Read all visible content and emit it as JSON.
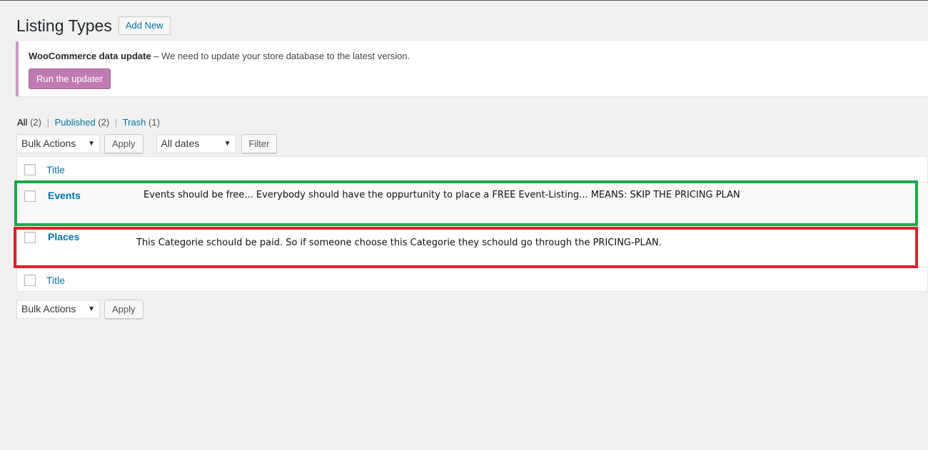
{
  "page": {
    "title": "Listing Types",
    "add_new_label": "Add New"
  },
  "notice": {
    "title": "WooCommerce data update",
    "message": " – We need to update your store database to the latest version.",
    "button_label": "Run the updater"
  },
  "views": [
    {
      "label": "All",
      "count": "(2)"
    },
    {
      "label": "Published",
      "count": "(2)"
    },
    {
      "label": "Trash",
      "count": "(1)"
    }
  ],
  "separator": "|",
  "tablenav_top": {
    "bulk_actions": "Bulk Actions",
    "apply": "Apply",
    "dates": "All dates",
    "filter": "Filter"
  },
  "tablenav_bottom": {
    "bulk_actions": "Bulk Actions",
    "apply": "Apply"
  },
  "table": {
    "column_title": "Title",
    "rows": [
      {
        "title": "Events",
        "note": "Events should be free... Everybody should have the oppurtunity to place a FREE Event-Listing... MEANS: SKIP THE PRICING PLAN"
      },
      {
        "title": "Places",
        "note": "This Categorie schould be paid. So if someone choose this Categorie they schould go through the PRICING-PLAN."
      }
    ]
  },
  "icons": {
    "dropdown_caret": "▼"
  },
  "colors": {
    "link": "#0073aa",
    "notice_border": "#cc99c2",
    "updater_button": "#c17bb4",
    "highlight_green": "#1ea84b",
    "highlight_red": "#e0202a"
  }
}
